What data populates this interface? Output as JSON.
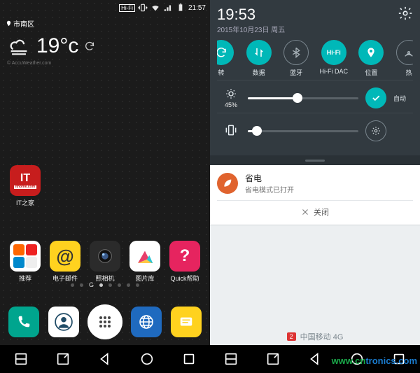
{
  "left": {
    "status": {
      "time": "21:57",
      "hifi": "Hi-Fi"
    },
    "location": "市南区",
    "weather": {
      "temp": "19°c",
      "attrib": "© AccuWeather.com"
    },
    "single_app": {
      "label": "IT之家",
      "badge": "IT"
    },
    "apps": [
      {
        "label": "推荐"
      },
      {
        "label": "电子邮件"
      },
      {
        "label": "照相机"
      },
      {
        "label": "图片库"
      },
      {
        "label": "Quick帮助"
      }
    ],
    "pager_g": "G"
  },
  "right": {
    "time": "19:53",
    "date": "2015年10月23日 周五",
    "qs": [
      {
        "label": "转",
        "on": true
      },
      {
        "label": "数据",
        "on": true
      },
      {
        "label": "蓝牙",
        "on": false
      },
      {
        "label": "Hi-Fi DAC",
        "on": true,
        "text": "Hi·Fi"
      },
      {
        "label": "位置",
        "on": true
      },
      {
        "label": "热",
        "on": false
      }
    ],
    "brightness": {
      "pct": "45%",
      "auto": "自动",
      "value": 45
    },
    "volume": {
      "value": 8
    },
    "card": {
      "title": "省电",
      "sub": "省电模式已打开",
      "close": "关闭"
    },
    "carrier": {
      "sim": "2",
      "name": "中国移动 4G"
    }
  },
  "watermark": {
    "a": "www.",
    "b": "cn",
    "c": "tronics",
    "d": ".com"
  }
}
